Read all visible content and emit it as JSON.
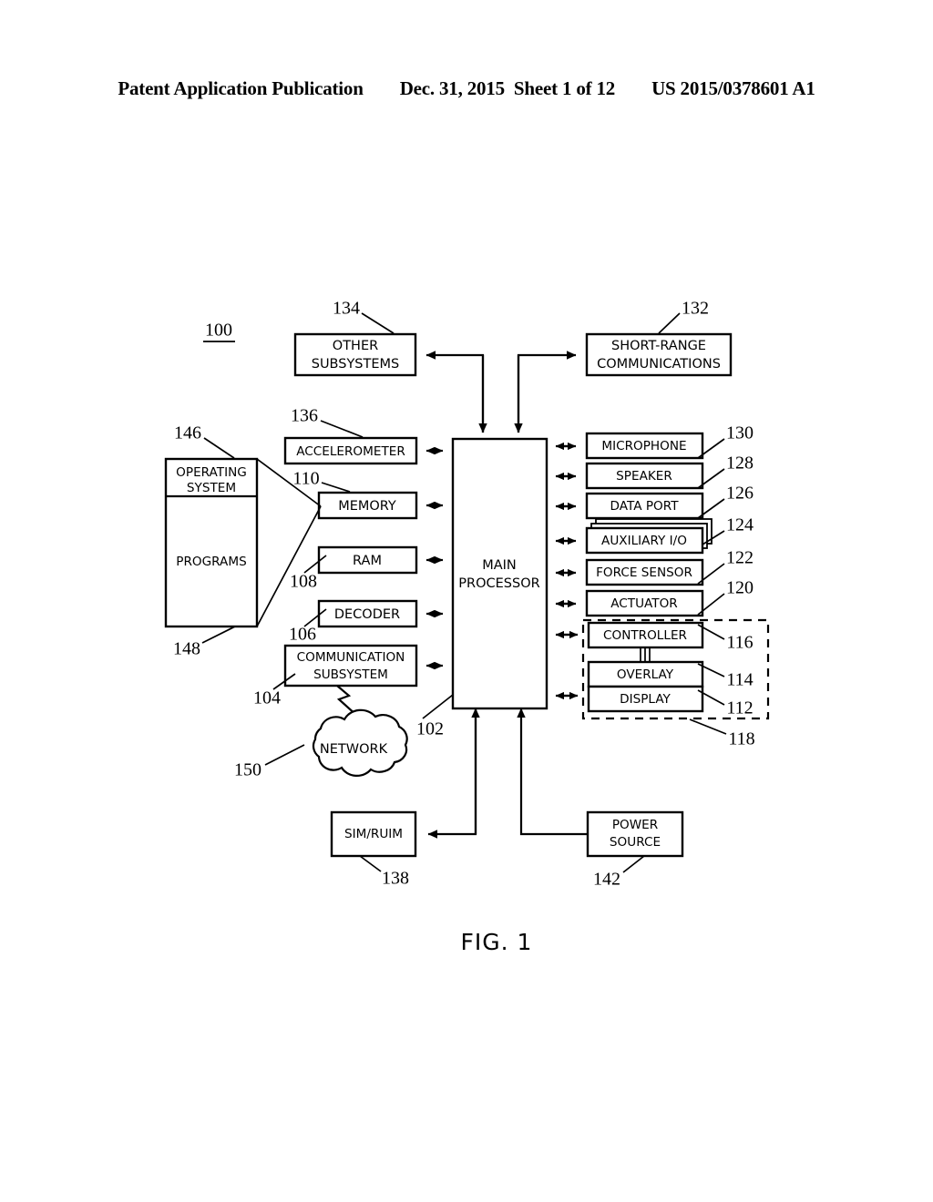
{
  "header": {
    "publication": "Patent Application Publication",
    "date": "Dec. 31, 2015",
    "sheet": "Sheet 1 of 12",
    "number": "US 2015/0378601 A1"
  },
  "figure": {
    "caption": "FIG. 1",
    "system_ref": "100"
  },
  "blocks": {
    "other_subsystems": {
      "label_line1": "OTHER",
      "label_line2": "SUBSYSTEMS",
      "ref": "134"
    },
    "short_range": {
      "label_line1": "SHORT-RANGE",
      "label_line2": "COMMUNICATIONS",
      "ref": "132"
    },
    "accelerometer": {
      "label": "ACCELEROMETER",
      "ref": "136"
    },
    "memory": {
      "label": "MEMORY",
      "ref": "110"
    },
    "ram": {
      "label": "RAM",
      "ref": "108"
    },
    "decoder": {
      "label": "DECODER",
      "ref": "106"
    },
    "communication_subsystem": {
      "label_line1": "COMMUNICATION",
      "label_line2": "SUBSYSTEM",
      "ref": "104"
    },
    "operating_system": {
      "label_line1": "OPERATING",
      "label_line2": "SYSTEM",
      "ref": "146"
    },
    "programs": {
      "label": "PROGRAMS",
      "ref": "148"
    },
    "main_processor": {
      "label_line1": "MAIN",
      "label_line2": "PROCESSOR",
      "ref": "102"
    },
    "microphone": {
      "label": "MICROPHONE",
      "ref": "130"
    },
    "speaker": {
      "label": "SPEAKER",
      "ref": "128"
    },
    "data_port": {
      "label": "DATA PORT",
      "ref": "126"
    },
    "auxiliary_io": {
      "label": "AUXILIARY I/O",
      "ref": "124"
    },
    "force_sensor": {
      "label": "FORCE SENSOR",
      "ref": "122"
    },
    "actuator": {
      "label": "ACTUATOR",
      "ref": "120"
    },
    "controller": {
      "label": "CONTROLLER",
      "ref": "116"
    },
    "overlay": {
      "label": "OVERLAY",
      "ref": "114"
    },
    "display": {
      "label": "DISPLAY",
      "ref": "112"
    },
    "touch_assembly": {
      "ref": "118"
    },
    "network": {
      "label": "NETWORK",
      "ref": "150"
    },
    "sim_ruim": {
      "label": "SIM/RUIM",
      "ref": "138"
    },
    "power_source": {
      "label_line1": "POWER",
      "label_line2": "SOURCE",
      "ref": "142"
    }
  }
}
